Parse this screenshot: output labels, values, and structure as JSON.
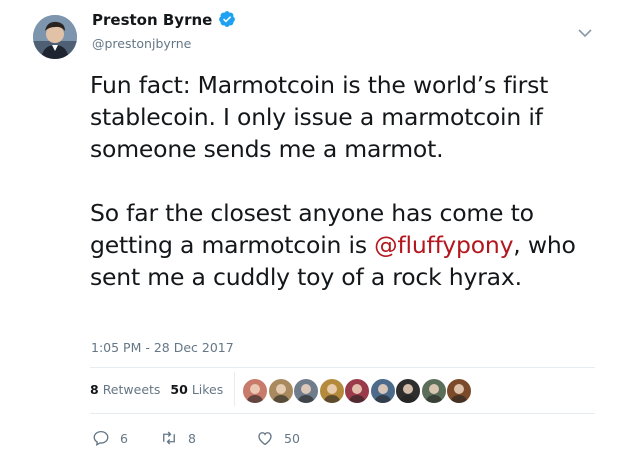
{
  "author": {
    "name": "Preston Byrne",
    "handle": "@prestonjbyrne",
    "verified": true
  },
  "tweet": {
    "para1": "Fun fact: Marmotcoin is the world’s first stablecoin. I only issue a marmotcoin if someone sends me a marmot.",
    "para2_before": "So far the closest anyone has come to getting a marmotcoin is ",
    "para2_mention": "@fluffypony",
    "para2_after": ", who sent me a cuddly toy of a rock hyrax.",
    "timestamp": "1:05 PM - 28 Dec 2017"
  },
  "stats": {
    "retweets_count": "8",
    "retweets_label": "Retweets",
    "likes_count": "50",
    "likes_label": "Likes"
  },
  "likers": [
    {
      "icon": "liker-avatar-1",
      "color": "#c97b6b"
    },
    {
      "icon": "liker-avatar-2",
      "color": "#a88a5e"
    },
    {
      "icon": "liker-avatar-3",
      "color": "#6f7c8c"
    },
    {
      "icon": "liker-avatar-4",
      "color": "#b48a3c"
    },
    {
      "icon": "liker-avatar-5",
      "color": "#9a3a4a"
    },
    {
      "icon": "liker-avatar-6",
      "color": "#4c6a8a"
    },
    {
      "icon": "liker-avatar-7",
      "color": "#2e2e2e"
    },
    {
      "icon": "liker-avatar-8",
      "color": "#5a6e5a"
    },
    {
      "icon": "liker-avatar-9",
      "color": "#7a4a2a"
    }
  ],
  "actions": {
    "replies": "6",
    "retweets": "8",
    "likes": "50"
  },
  "colors": {
    "mention": "#b4161e",
    "muted": "#657786",
    "verified": "#1da1f2"
  }
}
